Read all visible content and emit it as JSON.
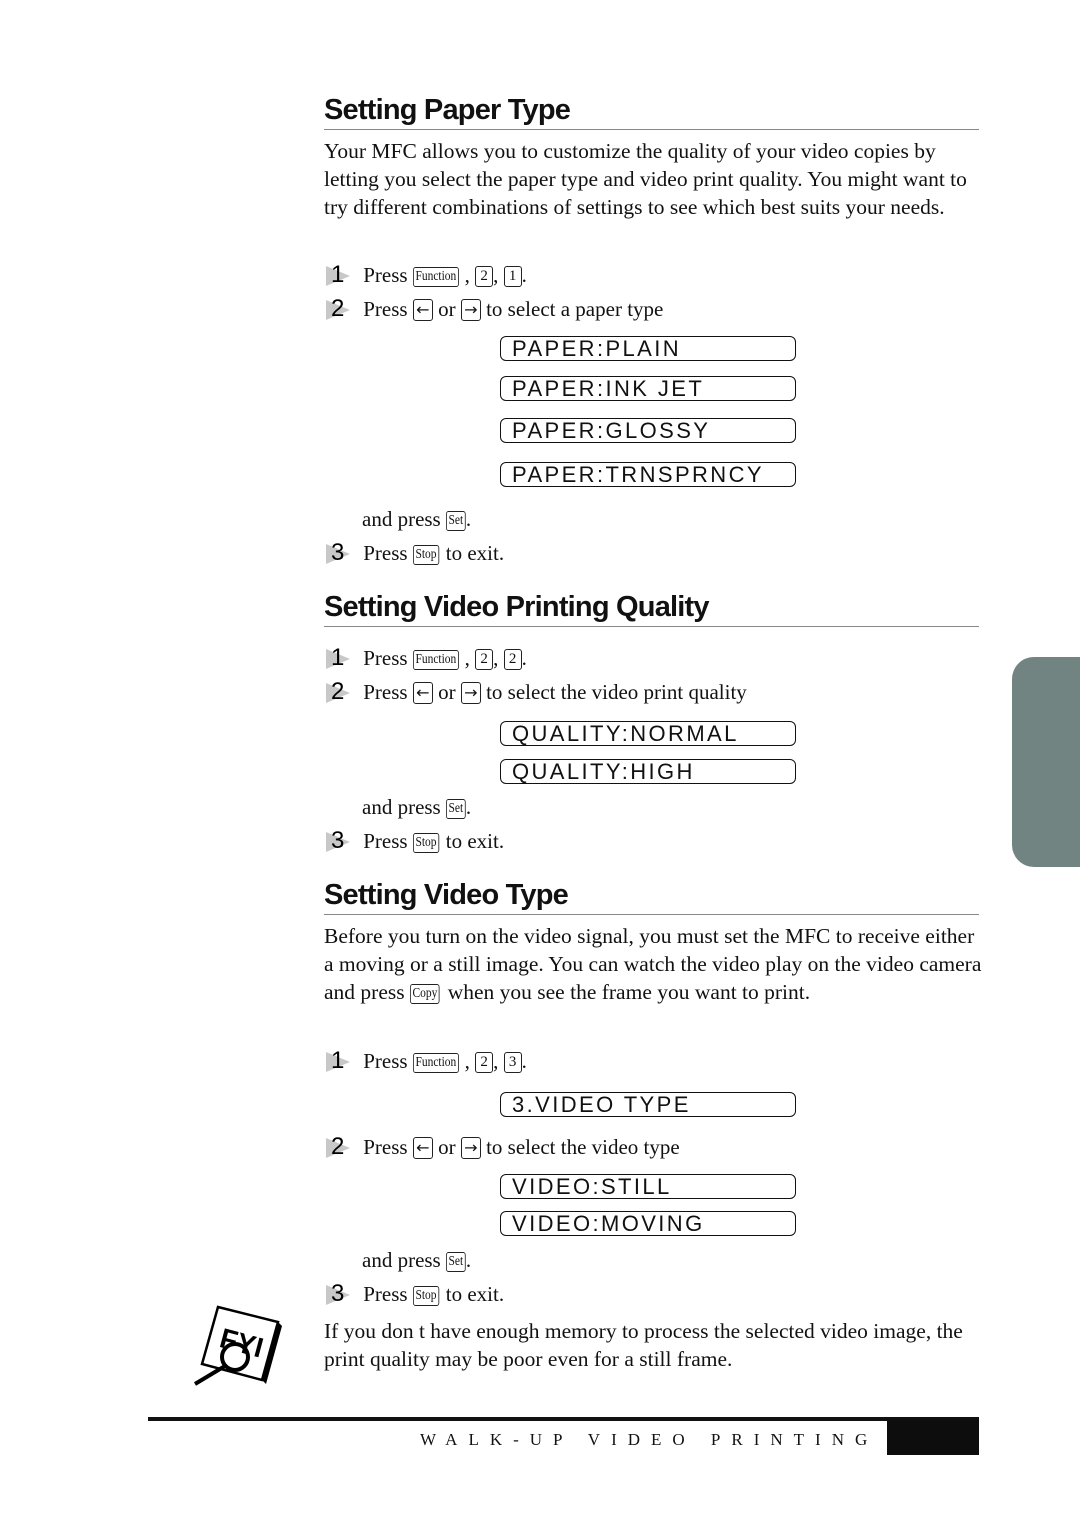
{
  "sections": [
    {
      "title": "Setting Paper Type",
      "intro": "Your MFC allows you to customize the quality of your video copies by letting you select the paper type and video print quality. You might want to try different combinations of settings to see which best suits your needs.",
      "step1": {
        "num": "1",
        "press": "Press",
        "keys": [
          "Function",
          "2",
          "1"
        ]
      },
      "step2": {
        "num": "2",
        "press": "Press",
        "left_key": "←",
        "or": "or",
        "right_key": "→",
        "text": "to select a paper type"
      },
      "displays": [
        "PAPER:PLAIN",
        "PAPER:INK JET",
        "PAPER:GLOSSY",
        "PAPER:TRNSPRNCY"
      ],
      "and_press": "and press",
      "set_key": "Set",
      "step3": {
        "num": "3",
        "press": "Press",
        "key": "Stop",
        "text": "to exit."
      }
    },
    {
      "title": "Setting Video Printing Quality",
      "step1": {
        "num": "1",
        "press": "Press",
        "keys": [
          "Function",
          "2",
          "2"
        ]
      },
      "step2": {
        "num": "2",
        "press": "Press",
        "left_key": "←",
        "or": "or",
        "right_key": "→",
        "text": "to select the video print quality"
      },
      "displays": [
        "QUALITY:NORMAL",
        "QUALITY:HIGH"
      ],
      "and_press": "and press",
      "set_key": "Set",
      "step3": {
        "num": "3",
        "press": "Press",
        "key": "Stop",
        "text": "to exit."
      }
    },
    {
      "title": "Setting Video Type",
      "intro_a": "Before you turn on the video signal, you must set the MFC to receive either a moving or a still image. You can watch the video play on the video camera and press",
      "intro_key": "Copy",
      "intro_b": "when you see the frame you want to print.",
      "step1": {
        "num": "1",
        "press": "Press",
        "keys": [
          "Function",
          "2",
          "3"
        ]
      },
      "display_menu": "3.VIDEO TYPE",
      "step2": {
        "num": "2",
        "press": "Press",
        "left_key": "←",
        "or": "or",
        "right_key": "→",
        "text": "to select the video type"
      },
      "displays": [
        "VIDEO:STILL",
        "VIDEO:MOVING"
      ],
      "and_press": "and press",
      "set_key": "Set",
      "step3": {
        "num": "3",
        "press": "Press",
        "key": "Stop",
        "text": "to exit."
      }
    }
  ],
  "fyi": {
    "icon": "fyi-magnifier-icon",
    "text": "If you don t have enough memory to process the selected video image, the print quality may be poor even for a still frame."
  },
  "footer": {
    "chapter": "WALK-UP VIDEO PRINTING"
  },
  "colors": {
    "tab": "#728482",
    "step_triangle": "#c8c8c8"
  }
}
